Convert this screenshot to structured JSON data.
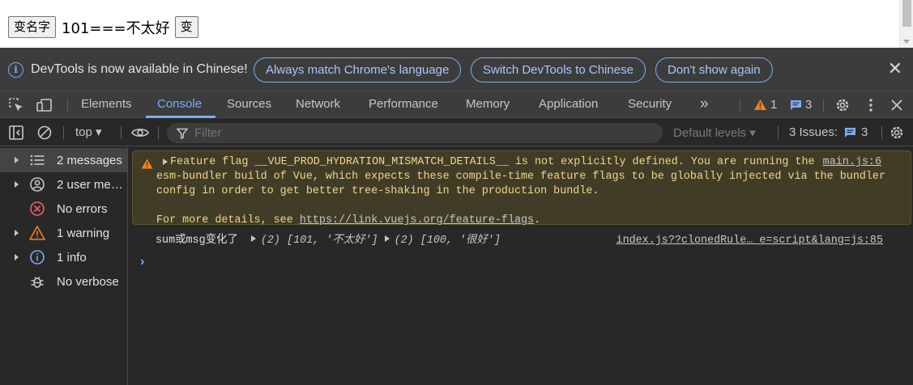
{
  "page": {
    "rename_button": "变名字",
    "display_text": "101===不太好",
    "change_button": "变"
  },
  "infobar": {
    "message": "DevTools is now available in Chinese!",
    "btn_match": "Always match Chrome's language",
    "btn_switch": "Switch DevTools to Chinese",
    "btn_dont_show": "Don't show again",
    "close": "✕"
  },
  "toolbar": {
    "tabs": [
      "Elements",
      "Console",
      "Sources",
      "Network",
      "Performance",
      "Memory",
      "Application",
      "Security"
    ],
    "active_tab": "Console",
    "more": "»",
    "warning_count": "1",
    "message_count": "3"
  },
  "console_toolbar": {
    "context": "top ▾",
    "filter_placeholder": "Filter",
    "levels": "Default levels ▾",
    "issues_label": "3 Issues:",
    "issues_count": "3"
  },
  "sidebar": {
    "items": [
      {
        "label": "2 messages",
        "icon": "list-icon"
      },
      {
        "label": "2 user me…",
        "icon": "user-icon"
      },
      {
        "label": "No errors",
        "icon": "error-icon"
      },
      {
        "label": "1 warning",
        "icon": "warning-icon"
      },
      {
        "label": "1 info",
        "icon": "info-icon"
      },
      {
        "label": "No verbose",
        "icon": "bug-icon"
      }
    ]
  },
  "console": {
    "warning": {
      "line1": "Feature flag __VUE_PROD_HYDRATION_MISMATCH_DETAILS__ is not explicitly defined. You are running the",
      "line2": "esm-bundler build of Vue, which expects these compile-time feature flags to be globally injected via the bundler",
      "line3": "config in order to get better tree-shaking in the production bundle.",
      "line5_prefix": "For more details, see ",
      "link": "https://link.vuejs.org/feature-flags",
      "line5_suffix": ".",
      "source": "main.js:6"
    },
    "log": {
      "text": "sum或msg变化了",
      "arr1_len": "(2)",
      "arr1_num": "101",
      "arr1_str": "'不太好'",
      "arr2_len": "(2)",
      "arr2_num": "100",
      "arr2_str": "'很好'",
      "source": "index.js??clonedRule… e=script&lang=js:85"
    },
    "prompt": "›"
  },
  "colors": {
    "accent": "#7cacf8",
    "warning_bg": "#413c26",
    "warning_text": "#f2d58e",
    "panel_bg": "#282828",
    "toolbar_bg": "#3c3c3c"
  }
}
